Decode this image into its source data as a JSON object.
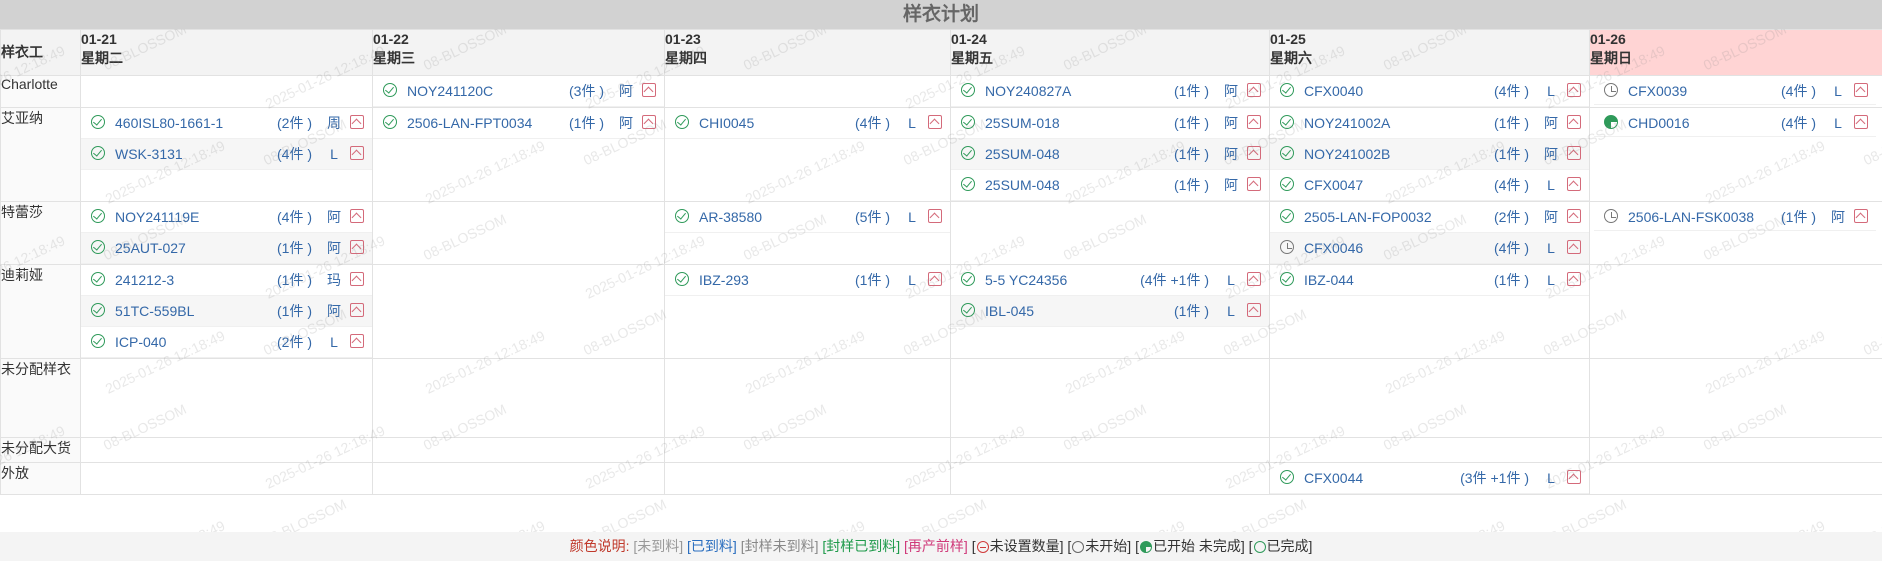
{
  "page": {
    "title": "样衣计划"
  },
  "corner_label": "样衣工",
  "days": [
    {
      "date": "01-21",
      "weekday": "星期二"
    },
    {
      "date": "01-22",
      "weekday": "星期三"
    },
    {
      "date": "01-23",
      "weekday": "星期四"
    },
    {
      "date": "01-24",
      "weekday": "星期五"
    },
    {
      "date": "01-25",
      "weekday": "星期六"
    },
    {
      "date": "01-26",
      "weekday": "星期日"
    }
  ],
  "rows": [
    {
      "label": "Charlotte",
      "cells": [
        [],
        [
          {
            "status": "done",
            "code": "NOY241120C",
            "qty": "(3件 )",
            "person": "阿"
          }
        ],
        [],
        [
          {
            "status": "done",
            "code": "NOY240827A",
            "qty": "(1件 )",
            "person": "阿"
          }
        ],
        [
          {
            "status": "done",
            "code": "CFX0040",
            "qty": "(4件 )",
            "person": "L"
          }
        ],
        [
          {
            "status": "notstart",
            "code": "CFX0039",
            "qty": "(4件 )",
            "person": "L"
          }
        ]
      ]
    },
    {
      "label": "艾亚纳",
      "cells": [
        [
          {
            "status": "done",
            "code": "460ISL80-1661-1",
            "qty": "(2件 )",
            "person": "周"
          },
          {
            "status": "done",
            "code": "WSK-3131",
            "qty": "(4件 )",
            "person": "L"
          }
        ],
        [
          {
            "status": "done",
            "code": "2506-LAN-FPT0034",
            "qty": "(1件 )",
            "person": "阿"
          }
        ],
        [
          {
            "status": "done",
            "code": "CHI0045",
            "qty": "(4件 )",
            "person": "L"
          }
        ],
        [
          {
            "status": "done",
            "code": "25SUM-018",
            "qty": "(1件 )",
            "person": "阿"
          },
          {
            "status": "done",
            "code": "25SUM-048",
            "qty": "(1件 )",
            "person": "阿"
          },
          {
            "status": "done",
            "code": "25SUM-048",
            "qty": "(1件 )",
            "person": "阿"
          }
        ],
        [
          {
            "status": "done",
            "code": "NOY241002A",
            "qty": "(1件 )",
            "person": "阿"
          },
          {
            "status": "done",
            "code": "NOY241002B",
            "qty": "(1件 )",
            "person": "阿"
          },
          {
            "status": "done",
            "code": "CFX0047",
            "qty": "(4件 )",
            "person": "L"
          }
        ],
        [
          {
            "status": "partial",
            "code": "CHD0016",
            "qty": "(4件 )",
            "person": "L"
          }
        ]
      ]
    },
    {
      "label": "特蕾莎",
      "cells": [
        [
          {
            "status": "done",
            "code": "NOY241119E",
            "qty": "(4件 )",
            "person": "阿"
          },
          {
            "status": "done",
            "code": "25AUT-027",
            "qty": "(1件 )",
            "person": "阿"
          }
        ],
        [],
        [
          {
            "status": "done",
            "code": "AR-38580",
            "qty": "(5件 )",
            "person": "L"
          }
        ],
        [],
        [
          {
            "status": "done",
            "code": "2505-LAN-FOP0032",
            "qty": "(2件 )",
            "person": "阿"
          },
          {
            "status": "notstart",
            "code": "CFX0046",
            "qty": "(4件 )",
            "person": "L"
          }
        ],
        [
          {
            "status": "notstart",
            "code": "2506-LAN-FSK0038",
            "qty": "(1件 )",
            "person": "阿"
          }
        ]
      ]
    },
    {
      "label": "迪莉娅",
      "cells": [
        [
          {
            "status": "done",
            "code": "241212-3",
            "qty": "(1件 )",
            "person": "玛"
          },
          {
            "status": "done",
            "code": "51TC-559BL",
            "qty": "(1件 )",
            "person": "阿"
          },
          {
            "status": "done",
            "code": "ICP-040",
            "qty": "(2件 )",
            "person": "L"
          }
        ],
        [],
        [
          {
            "status": "done",
            "code": "IBZ-293",
            "qty": "(1件 )",
            "person": "L"
          }
        ],
        [
          {
            "status": "done",
            "code": "5-5 YC24356",
            "qty": "(4件 +1件 )",
            "person": "L"
          },
          {
            "status": "done",
            "code": "IBL-045",
            "qty": "(1件 )",
            "person": "L"
          }
        ],
        [
          {
            "status": "done",
            "code": "IBZ-044",
            "qty": "(1件 )",
            "person": "L"
          }
        ],
        []
      ]
    },
    {
      "label": "未分配样衣",
      "cells": [
        [],
        [],
        [],
        [],
        [],
        []
      ]
    },
    {
      "label": "未分配大货",
      "cells": [
        [],
        [],
        [],
        [],
        [],
        []
      ]
    },
    {
      "label": "外放",
      "cells": [
        [],
        [],
        [],
        [],
        [
          {
            "status": "done",
            "code": "CFX0044",
            "qty": "(3件 +1件 )",
            "person": "L"
          }
        ],
        []
      ]
    }
  ],
  "watermark": {
    "date": "2025-01-26 12:18:49",
    "brand": "08-BLOSSOM"
  },
  "legend": {
    "title": "颜色说明:",
    "items": [
      "[未到料]",
      "[已到料]",
      "[封样未到料]",
      "[封样已到料]",
      "[再产前样]"
    ],
    "status_items": [
      "未设置数量]",
      "未开始]",
      "已开始 未完成]",
      "已完成]"
    ],
    "bracket": "["
  },
  "colors": {
    "header_bg": "#d2d2d2",
    "sunday_bg": "#ffd4d4",
    "done_green": "#2f9a5a",
    "code_blue": "#3468a8",
    "image_icon": "#d46a7a"
  }
}
